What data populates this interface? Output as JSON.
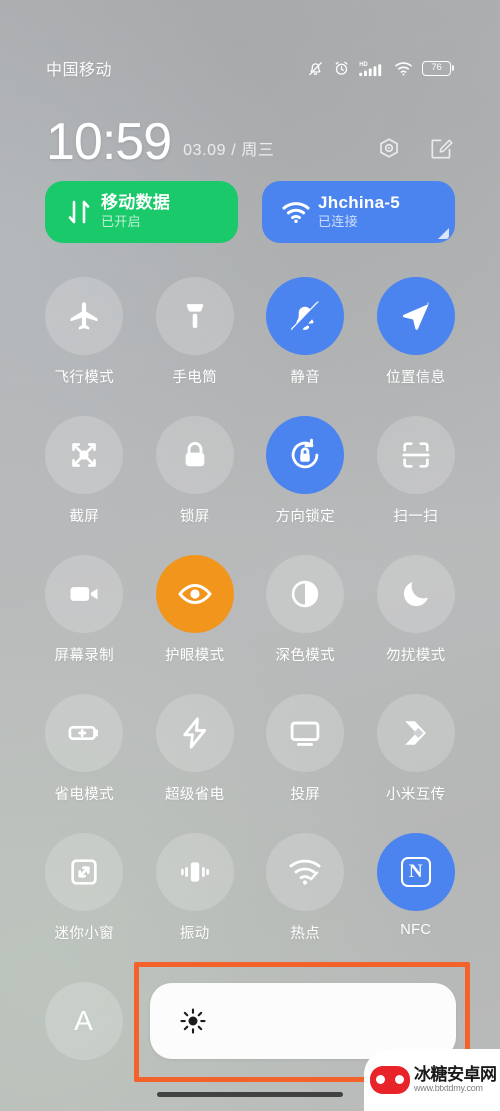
{
  "statusbar": {
    "carrier": "中国移动",
    "battery_percent": "76",
    "icons": [
      "mute-bell-icon",
      "alarm-clock-icon",
      "hd-signal-icon",
      "wifi-icon",
      "battery-icon"
    ]
  },
  "clock": {
    "time": "10:59",
    "date": "03.09 / 周三",
    "settings_icon": "gear-icon",
    "edit_icon": "edit-icon"
  },
  "cards": [
    {
      "name": "mobile-data-card",
      "title": "移动数据",
      "subtitle": "已开启",
      "icon": "data-arrows-icon",
      "color": "#19c96a",
      "state": "on"
    },
    {
      "name": "wifi-card",
      "title": "Jhchina-5",
      "subtitle": "已连接",
      "icon": "wifi-icon",
      "color": "#4b84ef",
      "state": "on"
    }
  ],
  "toggles": [
    {
      "label": "飞行模式",
      "icon": "airplane-icon",
      "state": "off"
    },
    {
      "label": "手电筒",
      "icon": "flashlight-icon",
      "state": "off"
    },
    {
      "label": "静音",
      "icon": "mute-bell-icon",
      "state": "on"
    },
    {
      "label": "位置信息",
      "icon": "location-arrow-icon",
      "state": "on"
    },
    {
      "label": "截屏",
      "icon": "screenshot-icon",
      "state": "off"
    },
    {
      "label": "锁屏",
      "icon": "lock-icon",
      "state": "off"
    },
    {
      "label": "方向锁定",
      "icon": "rotation-lock-icon",
      "state": "on"
    },
    {
      "label": "扫一扫",
      "icon": "scan-icon",
      "state": "off"
    },
    {
      "label": "屏幕录制",
      "icon": "video-camera-icon",
      "state": "off"
    },
    {
      "label": "护眼模式",
      "icon": "eye-icon",
      "state": "on"
    },
    {
      "label": "深色模式",
      "icon": "contrast-icon",
      "state": "off"
    },
    {
      "label": "勿扰模式",
      "icon": "moon-icon",
      "state": "off"
    },
    {
      "label": "省电模式",
      "icon": "battery-plus-icon",
      "state": "off"
    },
    {
      "label": "超级省电",
      "icon": "bolt-icon",
      "state": "off"
    },
    {
      "label": "投屏",
      "icon": "monitor-icon",
      "state": "off"
    },
    {
      "label": "小米互传",
      "icon": "mi-share-icon",
      "state": "off"
    },
    {
      "label": "迷你小窗",
      "icon": "mini-window-icon",
      "state": "off"
    },
    {
      "label": "振动",
      "icon": "vibrate-icon",
      "state": "off"
    },
    {
      "label": "热点",
      "icon": "hotspot-icon",
      "state": "off"
    },
    {
      "label": "NFC",
      "icon": "nfc-icon",
      "state": "on"
    }
  ],
  "brightness": {
    "auto_label": "A",
    "slider_icon": "sun-icon",
    "highlight_color": "#f2622a"
  },
  "watermark": {
    "title": "冰糖安卓网",
    "url": "www.btxtdmy.com",
    "logo": "gamepad-logo-icon"
  },
  "colors": {
    "accent_blue": "#4b84ef",
    "accent_green": "#19c96a",
    "accent_orange": "#f2951d",
    "highlight": "#f2622a"
  }
}
